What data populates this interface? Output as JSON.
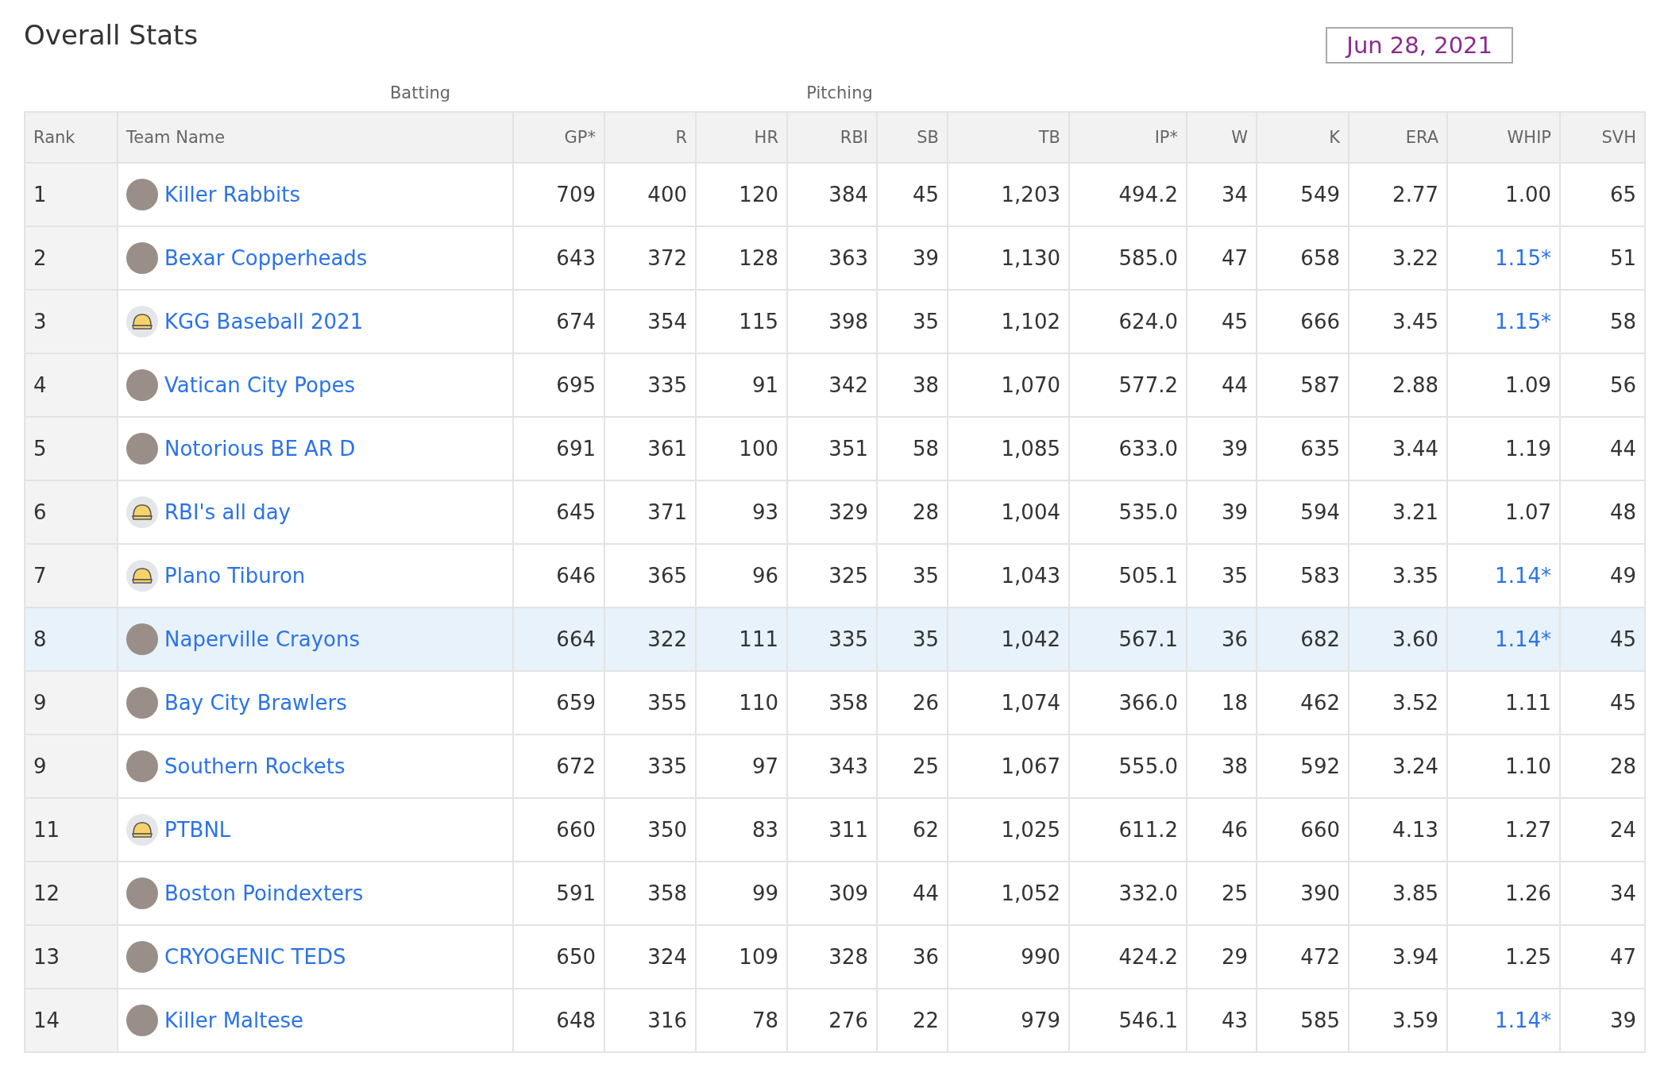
{
  "title": "Overall Stats",
  "date": "Jun 28, 2021",
  "groups": [
    "Batting",
    "Pitching"
  ],
  "columns": [
    "Rank",
    "Team Name",
    "GP*",
    "R",
    "HR",
    "RBI",
    "SB",
    "TB",
    "IP*",
    "W",
    "K",
    "ERA",
    "WHIP",
    "SVH"
  ],
  "rows": [
    {
      "rank": "1",
      "team": "Killer Rabbits",
      "kind": "image",
      "selected": false,
      "stats": [
        "709",
        "400",
        "120",
        "384",
        "45",
        "1,203",
        "494.2",
        "34",
        "549",
        "2.77"
      ],
      "whip": {
        "text": "1.00",
        "link": false
      },
      "svh": "65"
    },
    {
      "rank": "2",
      "team": "Bexar Copperheads",
      "kind": "image",
      "selected": false,
      "stats": [
        "643",
        "372",
        "128",
        "363",
        "39",
        "1,130",
        "585.0",
        "47",
        "658",
        "3.22"
      ],
      "whip": {
        "text": "1.15*",
        "link": true
      },
      "svh": "51"
    },
    {
      "rank": "3",
      "team": "KGG Baseball 2021",
      "kind": "cap",
      "selected": false,
      "stats": [
        "674",
        "354",
        "115",
        "398",
        "35",
        "1,102",
        "624.0",
        "45",
        "666",
        "3.45"
      ],
      "whip": {
        "text": "1.15*",
        "link": true
      },
      "svh": "58"
    },
    {
      "rank": "4",
      "team": "Vatican City Popes",
      "kind": "image",
      "selected": false,
      "stats": [
        "695",
        "335",
        "91",
        "342",
        "38",
        "1,070",
        "577.2",
        "44",
        "587",
        "2.88"
      ],
      "whip": {
        "text": "1.09",
        "link": false
      },
      "svh": "56"
    },
    {
      "rank": "5",
      "team": "Notorious BE AR D",
      "kind": "image",
      "selected": false,
      "stats": [
        "691",
        "361",
        "100",
        "351",
        "58",
        "1,085",
        "633.0",
        "39",
        "635",
        "3.44"
      ],
      "whip": {
        "text": "1.19",
        "link": false
      },
      "svh": "44"
    },
    {
      "rank": "6",
      "team": "RBI's all day",
      "kind": "cap",
      "selected": false,
      "stats": [
        "645",
        "371",
        "93",
        "329",
        "28",
        "1,004",
        "535.0",
        "39",
        "594",
        "3.21"
      ],
      "whip": {
        "text": "1.07",
        "link": false
      },
      "svh": "48"
    },
    {
      "rank": "7",
      "team": "Plano Tiburon",
      "kind": "cap",
      "selected": false,
      "stats": [
        "646",
        "365",
        "96",
        "325",
        "35",
        "1,043",
        "505.1",
        "35",
        "583",
        "3.35"
      ],
      "whip": {
        "text": "1.14*",
        "link": true
      },
      "svh": "49"
    },
    {
      "rank": "8",
      "team": "Naperville Crayons",
      "kind": "image",
      "selected": true,
      "stats": [
        "664",
        "322",
        "111",
        "335",
        "35",
        "1,042",
        "567.1",
        "36",
        "682",
        "3.60"
      ],
      "whip": {
        "text": "1.14*",
        "link": true
      },
      "svh": "45"
    },
    {
      "rank": "9",
      "team": "Bay City Brawlers",
      "kind": "image",
      "selected": false,
      "stats": [
        "659",
        "355",
        "110",
        "358",
        "26",
        "1,074",
        "366.0",
        "18",
        "462",
        "3.52"
      ],
      "whip": {
        "text": "1.11",
        "link": false
      },
      "svh": "45"
    },
    {
      "rank": "9",
      "team": "Southern Rockets",
      "kind": "image",
      "selected": false,
      "stats": [
        "672",
        "335",
        "97",
        "343",
        "25",
        "1,067",
        "555.0",
        "38",
        "592",
        "3.24"
      ],
      "whip": {
        "text": "1.10",
        "link": false
      },
      "svh": "28"
    },
    {
      "rank": "11",
      "team": "PTBNL",
      "kind": "cap",
      "selected": false,
      "stats": [
        "660",
        "350",
        "83",
        "311",
        "62",
        "1,025",
        "611.2",
        "46",
        "660",
        "4.13"
      ],
      "whip": {
        "text": "1.27",
        "link": false
      },
      "svh": "24"
    },
    {
      "rank": "12",
      "team": "Boston Poindexters",
      "kind": "image",
      "selected": false,
      "stats": [
        "591",
        "358",
        "99",
        "309",
        "44",
        "1,052",
        "332.0",
        "25",
        "390",
        "3.85"
      ],
      "whip": {
        "text": "1.26",
        "link": false
      },
      "svh": "34"
    },
    {
      "rank": "13",
      "team": "CRYOGENIC TEDS",
      "kind": "image",
      "selected": false,
      "stats": [
        "650",
        "324",
        "109",
        "328",
        "36",
        "990",
        "424.2",
        "29",
        "472",
        "3.94"
      ],
      "whip": {
        "text": "1.25",
        "link": false
      },
      "svh": "47"
    },
    {
      "rank": "14",
      "team": "Killer Maltese",
      "kind": "image",
      "selected": false,
      "stats": [
        "648",
        "316",
        "78",
        "276",
        "22",
        "979",
        "546.1",
        "43",
        "585",
        "3.59"
      ],
      "whip": {
        "text": "1.14*",
        "link": true
      },
      "svh": "39"
    }
  ]
}
